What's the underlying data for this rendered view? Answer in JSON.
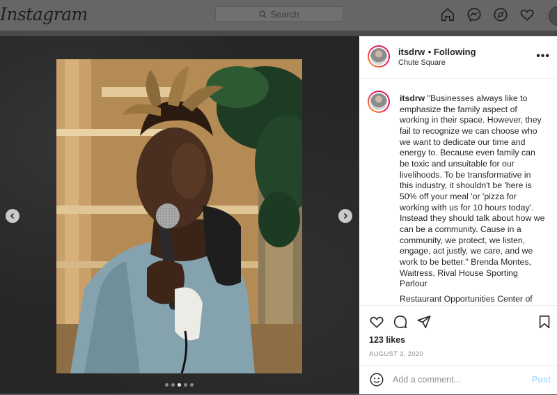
{
  "topbar": {
    "logo": "Instagram",
    "search_placeholder": "Search"
  },
  "post": {
    "username": "itsdrw",
    "follow_label": "• Following",
    "location": "Chute Square",
    "caption": "\"Businesses always like to emphasize the family aspect of working in their space. However, they fail to recognize we can choose who we want to dedicate our time and energy to. Because even family can be toxic and unsuitable for our livelihoods. To be transformative in this industry, it shouldn't be 'here is 50% off your meal 'or 'pizza for working with us for 10 hours today'. Instead they should talk about how we can be a community. Cause in a community, we protect, we listen, engage, act justly, we care, and we work to be better.\" Brenda Montes, Waitress, Rival House Sporting Parlour",
    "caption_more": "Restaurant Opportunities Center of",
    "likes": "123 likes",
    "date": "AUGUST 3, 2020",
    "comment_placeholder": "Add a comment...",
    "post_label": "Post",
    "more_label": "•••"
  },
  "carousel": {
    "count": 5,
    "active": 3
  }
}
